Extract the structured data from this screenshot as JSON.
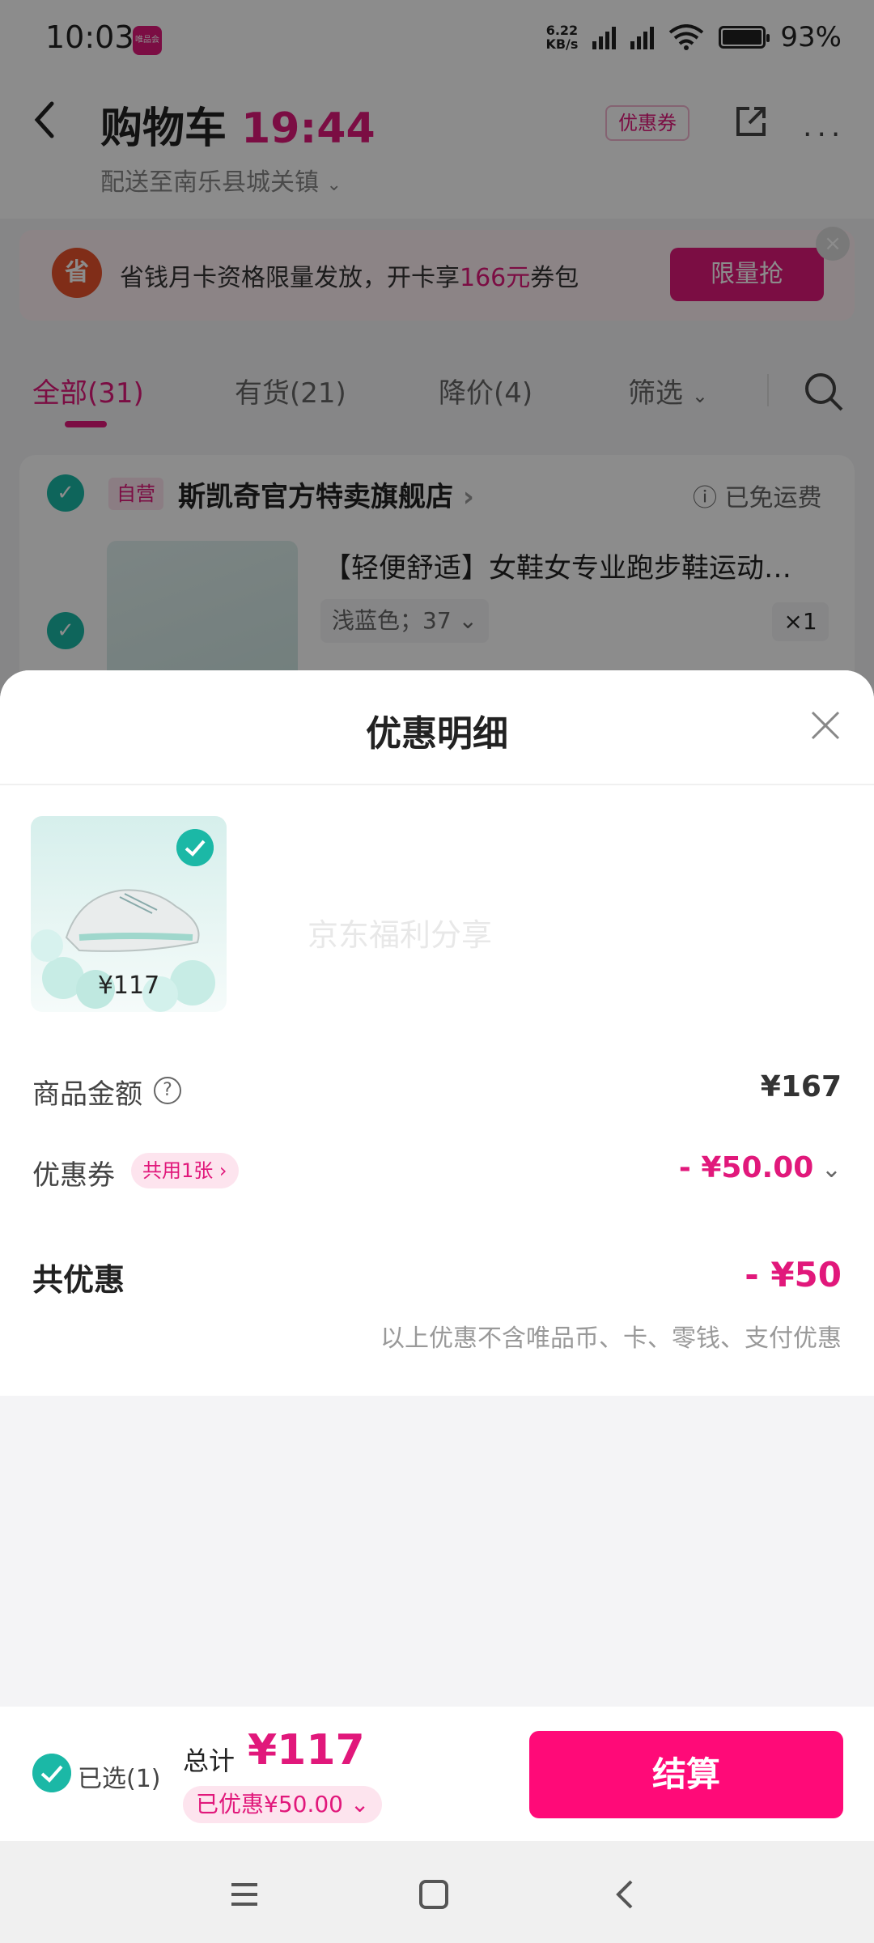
{
  "status_bar": {
    "time": "10:03",
    "app_icon_label": "唯品会",
    "net_speed_top": "6.22",
    "net_speed_bottom": "KB/s",
    "battery": "93%"
  },
  "header": {
    "title": "购物车",
    "timer": "19:44",
    "subtitle": "配送至南乐县城关镇",
    "coupon_chip": "优惠券"
  },
  "promo": {
    "badge": "省",
    "text_prefix": "省钱月卡资格限量发放，开卡享",
    "text_highlight": "166元",
    "text_suffix": "券包",
    "button": "限量抢",
    "close": "×"
  },
  "tabs": [
    {
      "label": "全部(31)"
    },
    {
      "label": "有货(21)"
    },
    {
      "label": "降价(4)"
    },
    {
      "label": "筛选"
    }
  ],
  "store": {
    "self_tag": "自营",
    "name": "斯凯奇官方特卖旗舰店",
    "shipping": "已免运费",
    "product_title": "【轻便舒适】女鞋女专业跑步鞋运动…",
    "product_spec": "浅蓝色；37",
    "product_qty": "×1"
  },
  "sheet": {
    "title": "优惠明细",
    "item_price": "¥117",
    "watermark": "京东福利分享",
    "goods_amount_label": "商品金额",
    "goods_amount_value": "¥167",
    "coupon_label": "优惠券",
    "coupon_tag": "共用1张",
    "coupon_value": "- ¥50.00",
    "total_label": "共优惠",
    "total_value": "- ¥50",
    "note": "以上优惠不含唯品币、卡、零钱、支付优惠"
  },
  "bottom_bar": {
    "selected": "已选(1)",
    "total_label": "总计",
    "total_value": "¥117",
    "discount": "已优惠¥50.00",
    "checkout": "结算"
  },
  "colors": {
    "brand": "#e1187b",
    "checkout": "#ff0a78",
    "check": "#1bb8a6"
  }
}
